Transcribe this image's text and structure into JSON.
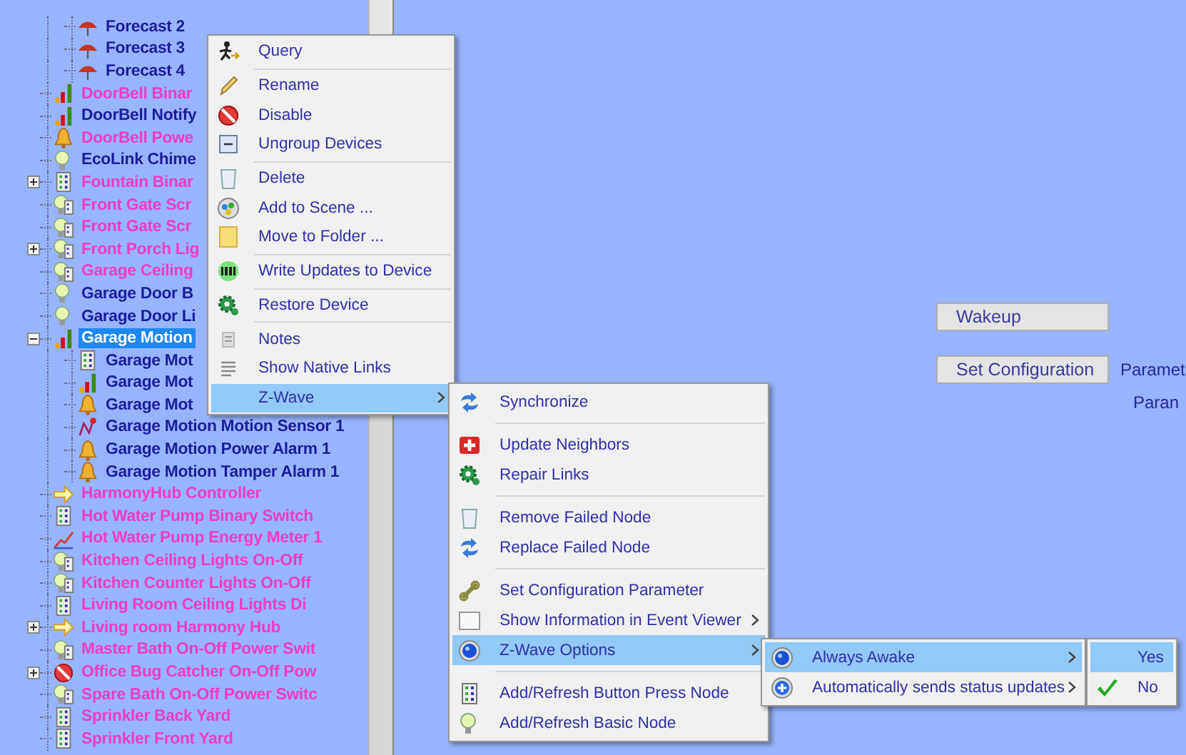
{
  "tree": {
    "continued_children": [
      {
        "label": "Forecast 2",
        "kind": "forecast",
        "color": "#1c1c9e",
        "selected": false
      },
      {
        "label": "Forecast 3",
        "kind": "forecast",
        "color": "#1c1c9e",
        "selected": false
      },
      {
        "label": "Forecast 4",
        "kind": "forecast",
        "color": "#1c1c9e",
        "selected": false
      }
    ],
    "items": [
      {
        "label": "DoorBell Binar",
        "kind": "meter",
        "color": "#f03cc8",
        "selected": false
      },
      {
        "label": "DoorBell Notify",
        "kind": "meter",
        "color": "#1c1c9e",
        "selected": false
      },
      {
        "label": "DoorBell Powe",
        "kind": "alarm",
        "color": "#f03cc8",
        "selected": false
      },
      {
        "label": "EcoLink Chime",
        "kind": "bulb",
        "color": "#1c1c9e",
        "selected": false
      },
      {
        "label": "Fountain Binar",
        "kind": "keypad",
        "color": "#f03cc8",
        "selected": false,
        "expanded": false
      },
      {
        "label": "Front Gate Scr",
        "kind": "bulb-keypad",
        "color": "#f03cc8",
        "selected": false
      },
      {
        "label": "Front Gate Scr",
        "kind": "bulb-keypad",
        "color": "#f03cc8",
        "selected": false
      },
      {
        "label": "Front Porch Lig",
        "kind": "bulb-keypad",
        "color": "#f03cc8",
        "selected": false,
        "expanded": false
      },
      {
        "label": "Garage Ceiling",
        "kind": "bulb-keypad",
        "color": "#f03cc8",
        "selected": false
      },
      {
        "label": "Garage Door B",
        "kind": "bulb",
        "color": "#1c1c9e",
        "selected": false
      },
      {
        "label": "Garage Door Li",
        "kind": "bulb",
        "color": "#1c1c9e",
        "selected": false
      },
      {
        "label": "Garage Motion",
        "kind": "meter",
        "selected": true,
        "expanded": true,
        "children": [
          {
            "label": "Garage Mot",
            "kind": "keypad",
            "color": "#1c1c9e",
            "selected": false
          },
          {
            "label": "Garage Mot",
            "kind": "meter",
            "color": "#1c1c9e",
            "selected": false
          },
          {
            "label": "Garage Mot",
            "kind": "alarm",
            "color": "#1c1c9e",
            "selected": false
          },
          {
            "label": "Garage Motion Motion Sensor 1",
            "kind": "sensor",
            "color": "#1c1c9e",
            "selected": false
          },
          {
            "label": "Garage Motion Power Alarm 1",
            "kind": "alarm",
            "color": "#1c1c9e",
            "selected": false
          },
          {
            "label": "Garage Motion Tamper Alarm 1",
            "kind": "alarm",
            "color": "#1c1c9e",
            "selected": false
          }
        ]
      },
      {
        "label": "HarmonyHub Controller",
        "kind": "controller",
        "color": "#f03cc8",
        "selected": false
      },
      {
        "label": "Hot Water Pump Binary Switch",
        "kind": "keypad",
        "color": "#f03cc8",
        "selected": false
      },
      {
        "label": "Hot Water Pump Energy Meter 1",
        "kind": "energy",
        "color": "#f03cc8",
        "selected": false
      },
      {
        "label": "Kitchen Ceiling Lights On-Off",
        "kind": "bulb-keypad",
        "color": "#f03cc8",
        "selected": false
      },
      {
        "label": "Kitchen Counter Lights On-Off",
        "kind": "bulb-keypad",
        "color": "#f03cc8",
        "selected": false
      },
      {
        "label": "Living Room Ceiling Lights Di",
        "kind": "keypad",
        "color": "#f03cc8",
        "selected": false
      },
      {
        "label": "Living room Harmony Hub",
        "kind": "controller",
        "color": "#f03cc8",
        "selected": false,
        "expanded": false
      },
      {
        "label": "Master Bath On-Off Power Swit",
        "kind": "bulb-keypad",
        "color": "#f03cc8",
        "selected": false
      },
      {
        "label": "Office Bug Catcher On-Off Pow",
        "kind": "disabled",
        "color": "#f03cc8",
        "selected": false,
        "expanded": false
      },
      {
        "label": "Spare Bath On-Off Power Switc",
        "kind": "bulb-keypad",
        "color": "#f03cc8",
        "selected": false
      },
      {
        "label": "Sprinkler Back Yard",
        "kind": "keypad",
        "color": "#f03cc8",
        "selected": false
      },
      {
        "label": "Sprinkler Front Yard",
        "kind": "keypad",
        "color": "#f03cc8",
        "selected": false
      }
    ]
  },
  "pane": {
    "buttons": [
      "Wakeup",
      "Set Configuration"
    ],
    "labels": [
      "Paramet",
      "Paran"
    ]
  },
  "menus": [
    {
      "groups": [
        [
          {
            "label": "Query",
            "kind": "query",
            "selected": false,
            "submenu": false
          }
        ],
        [
          {
            "label": "Rename",
            "kind": "rename",
            "selected": false,
            "submenu": false
          },
          {
            "label": "Disable",
            "kind": "disable",
            "selected": false,
            "submenu": false
          },
          {
            "label": "Ungroup Devices",
            "kind": "ungroup",
            "selected": false,
            "submenu": false
          }
        ],
        [
          {
            "label": "Delete",
            "kind": "delete",
            "selected": false,
            "submenu": false
          },
          {
            "label": "Add to Scene ...",
            "kind": "scene",
            "selected": false,
            "submenu": false
          },
          {
            "label": "Move to Folder ...",
            "kind": "folder",
            "selected": false,
            "submenu": false
          }
        ],
        [
          {
            "label": "Write Updates to Device",
            "kind": "write",
            "selected": false,
            "submenu": false
          }
        ],
        [
          {
            "label": "Restore Device",
            "kind": "gear",
            "selected": false,
            "submenu": false
          }
        ],
        [
          {
            "label": "Notes",
            "kind": "notes",
            "selected": false,
            "submenu": false
          },
          {
            "label": "Show Native Links",
            "kind": "links",
            "selected": false,
            "submenu": false
          },
          {
            "label": "Z-Wave",
            "kind": "plain",
            "selected": true,
            "submenu": true
          }
        ]
      ]
    },
    {
      "groups": [
        [
          {
            "label": "Synchronize",
            "kind": "sync",
            "selected": false,
            "submenu": false
          }
        ],
        [
          {
            "label": "Update Neighbors",
            "kind": "red-plus",
            "selected": false,
            "submenu": false
          },
          {
            "label": "Repair Links",
            "kind": "gear",
            "selected": false,
            "submenu": false
          }
        ],
        [
          {
            "label": "Remove Failed Node",
            "kind": "delete",
            "selected": false,
            "submenu": false
          },
          {
            "label": "Replace Failed Node",
            "kind": "sync",
            "selected": false,
            "submenu": false
          }
        ],
        [
          {
            "label": "Set Configuration Parameter",
            "kind": "wrench",
            "selected": false,
            "submenu": false
          },
          {
            "label": "Show Information in Event Viewer",
            "kind": "window",
            "selected": false,
            "submenu": true
          },
          {
            "label": "Z-Wave Options",
            "kind": "radio",
            "selected": true,
            "submenu": true
          }
        ],
        [
          {
            "label": "Add/Refresh Button Press Node",
            "kind": "keypad",
            "selected": false,
            "submenu": false
          },
          {
            "label": "Add/Refresh Basic Node",
            "kind": "bulb",
            "selected": false,
            "submenu": false
          }
        ]
      ]
    },
    {
      "groups": [
        [
          {
            "label": "Always Awake",
            "kind": "radio",
            "selected": true,
            "submenu": true
          },
          {
            "label": "Automatically sends status updates",
            "kind": "blue-plus",
            "selected": false,
            "submenu": true
          }
        ]
      ]
    },
    {
      "groups": [
        [
          {
            "label": "Yes",
            "kind": "choice",
            "selected": true,
            "submenu": false,
            "checked": false
          },
          {
            "label": "No",
            "kind": "choice",
            "selected": false,
            "submenu": false,
            "checked": true
          }
        ]
      ]
    }
  ]
}
